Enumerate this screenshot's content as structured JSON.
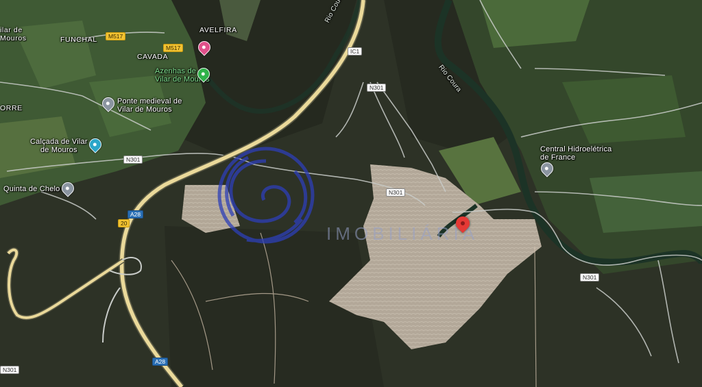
{
  "map": {
    "type": "satellite",
    "place_labels": {
      "vilar_de_mouros": "ilar de\nMouros",
      "funchal": "FUNCHAL",
      "avelfira": "AVELFIRA",
      "cavada": "CAVADA",
      "orre": "ORRE"
    },
    "poi_labels": {
      "azenhas": "Azenhas de\nVilar de Mouros",
      "ponte": "Ponte medieval de\nVilar de Mouros",
      "calcada": "Calçada de Vilar\nde Mouros",
      "quinta": "Quinta de Chelo",
      "central": "Central Hidroelétrica\nde France"
    },
    "river_labels": {
      "coura_north": "Rio Coura",
      "coura_east": "Rio Coura"
    },
    "road_shields": {
      "m517_a": "M517",
      "m517_b": "M517",
      "ic1": "IC1",
      "n301_a": "N301",
      "n301_b": "N301",
      "n301_c": "N301",
      "n301_d": "N301",
      "n301_e": "N301",
      "a28_a": "A28",
      "a28_b": "A28",
      "a20": "20"
    },
    "colors": {
      "forest": "#2b2f24",
      "clearing": "#b8ad9f",
      "highway": "#e9d79a",
      "road": "#c9ccc9",
      "river": "#1f3a2c",
      "pin_red": "#e53935",
      "poi_pink": "#e0508a",
      "poi_green": "#2fb24a",
      "poi_blue": "#2aa6c9",
      "poi_gray": "#8a94a0"
    },
    "watermark": {
      "text": "IMOBILIÁRIA"
    }
  }
}
